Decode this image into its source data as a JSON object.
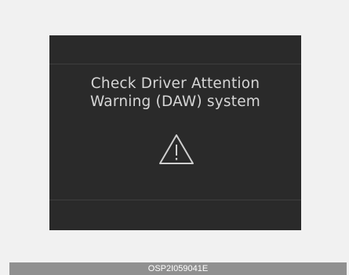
{
  "display": {
    "message_line1": "Check Driver Attention",
    "message_line2": "Warning (DAW) system",
    "icon": "warning-triangle-icon"
  },
  "footer": {
    "code": "OSP2I059041E"
  },
  "colors": {
    "page_background": "#f1f1f1",
    "screen_background": "#2a2a2a",
    "text": "#d6d6d6",
    "footer_bar": "#909090"
  }
}
